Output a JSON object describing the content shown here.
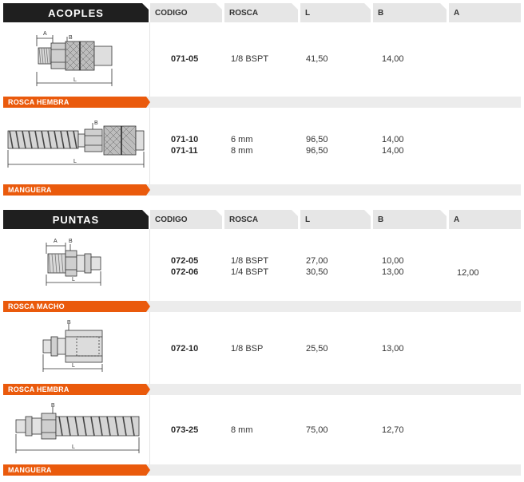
{
  "acoples": {
    "title": "ACOPLES",
    "columns": [
      "CODIGO",
      "ROSCA",
      "L",
      "B",
      "A"
    ],
    "groups": [
      {
        "label": "ROSCA HEMBRA",
        "rows": [
          {
            "codigo": "071-05",
            "rosca": "1/8 BSPT",
            "l": "41,50",
            "b": "14,00",
            "a": ""
          }
        ]
      },
      {
        "label": "MANGUERA",
        "rows": [
          {
            "codigo": "071-10",
            "rosca": "6 mm",
            "l": "96,50",
            "b": "14,00",
            "a": ""
          },
          {
            "codigo": "071-11",
            "rosca": "8 mm",
            "l": "96,50",
            "b": "14,00",
            "a": ""
          }
        ]
      }
    ]
  },
  "puntas": {
    "title": "PUNTAS",
    "columns": [
      "CODIGO",
      "ROSCA",
      "L",
      "B",
      "A"
    ],
    "groups": [
      {
        "label": "ROSCA MACHO",
        "rows": [
          {
            "codigo": "072-05",
            "rosca": "1/8 BSPT",
            "l": "27,00",
            "b": "10,00",
            "a": ""
          },
          {
            "codigo": "072-06",
            "rosca": "1/4 BSPT",
            "l": "30,50",
            "b": "13,00",
            "a": ""
          }
        ],
        "a_value": "12,00"
      },
      {
        "label": "ROSCA HEMBRA",
        "rows": [
          {
            "codigo": "072-10",
            "rosca": "1/8 BSP",
            "l": "25,50",
            "b": "13,00",
            "a": ""
          }
        ]
      },
      {
        "label": "MANGUERA",
        "rows": [
          {
            "codigo": "073-25",
            "rosca": "8 mm",
            "l": "75,00",
            "b": "12,70",
            "a": ""
          }
        ]
      }
    ]
  },
  "dim_labels": {
    "a": "A",
    "b": "B",
    "l": "L"
  },
  "colors": {
    "header_dark": "#1f1f1f",
    "header_light": "#e6e6e6",
    "accent_orange": "#ea5a0c",
    "band": "#ececec"
  }
}
